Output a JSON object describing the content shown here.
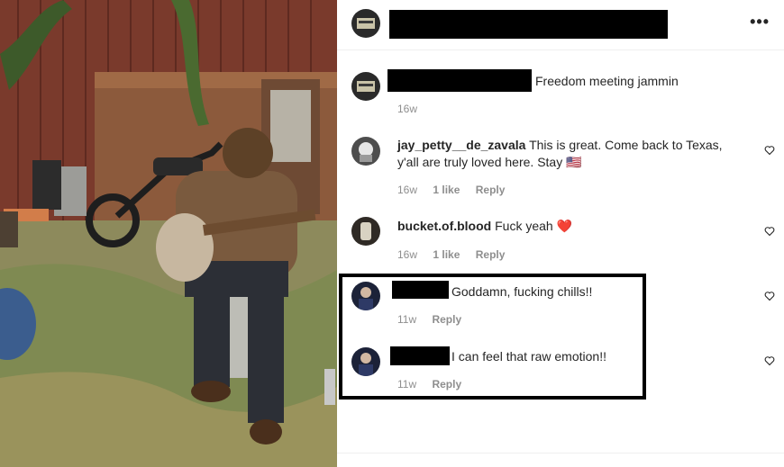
{
  "post": {
    "caption_text": "Freedom meeting jammin",
    "caption_time": "16w"
  },
  "header": {
    "more_label": "•••"
  },
  "comments": [
    {
      "username": "jay_petty__de_zavala",
      "text_line1": "This is great. Come back to Texas,",
      "text_line2": "y'all are truly loved here. Stay 🇺🇸",
      "time": "16w",
      "likes": "1 like",
      "reply": "Reply"
    },
    {
      "username": "bucket.of.blood",
      "text": "Fuck yeah ❤️",
      "time": "16w",
      "likes": "1 like",
      "reply": "Reply"
    },
    {
      "text": "Goddamn, fucking chills!!",
      "time": "11w",
      "reply": "Reply"
    },
    {
      "text": "I can feel that raw emotion!!",
      "time": "11w",
      "reply": "Reply"
    }
  ],
  "icons": {
    "heart": "heart-outline-icon",
    "more": "more-options-icon"
  },
  "colors": {
    "meta_text": "#8e8e8e",
    "body_text": "#262626",
    "redaction": "#000000"
  }
}
